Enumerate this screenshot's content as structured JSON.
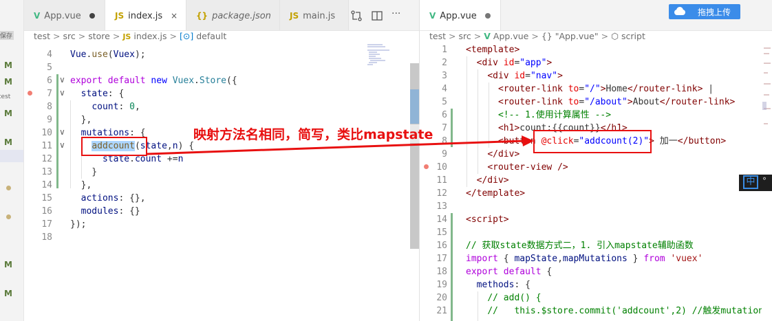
{
  "left_tabs": [
    {
      "label": "App.vue",
      "icon": "vue",
      "state": "modified"
    },
    {
      "label": "index.js",
      "icon": "js",
      "state": "active"
    },
    {
      "label": "package.json",
      "icon": "json",
      "state": "normal"
    },
    {
      "label": "main.js",
      "icon": "js",
      "state": "normal"
    }
  ],
  "right_tabs": [
    {
      "label": "App.vue",
      "icon": "vue",
      "state": "modified"
    }
  ],
  "upload_button": "拖拽上传",
  "close_glyph": "×",
  "left_breadcrumb": [
    "test",
    "src",
    "store",
    "index.js",
    "default"
  ],
  "right_breadcrumb": [
    "test",
    "src",
    "App.vue",
    "{} \"App.vue\"",
    "script"
  ],
  "activity": {
    "save_label": "保存",
    "test_label": "test",
    "mark": "M"
  },
  "left_line_numbers": [
    "4",
    "5",
    "6",
    "7",
    "8",
    "9",
    "10",
    "11",
    "12",
    "13",
    "14",
    "15",
    "16",
    "17",
    "18"
  ],
  "right_line_numbers": [
    "1",
    "2",
    "3",
    "4",
    "5",
    "6",
    "7",
    "8",
    "9",
    "10",
    "11",
    "12",
    "13",
    "14",
    "15",
    "16",
    "17",
    "18",
    "19",
    "20",
    "21"
  ],
  "annotation": "映射方法名相同，简写，类比mapstate",
  "ime_label": "中",
  "ime_extra": "°"
}
